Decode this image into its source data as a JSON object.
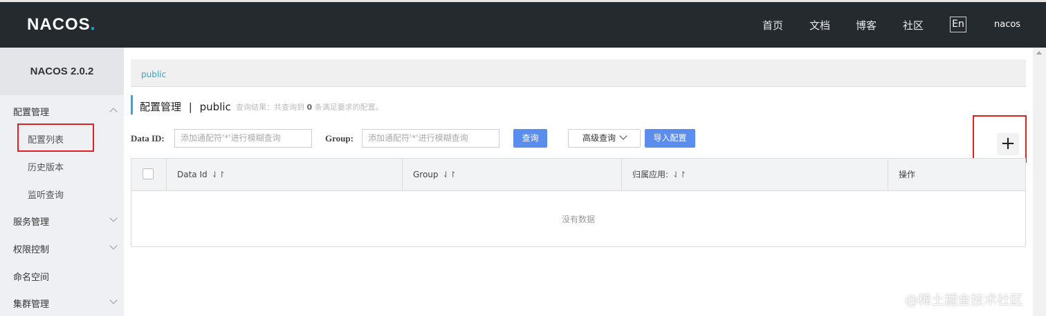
{
  "header": {
    "logo": "NACOS",
    "logo_dot": ".",
    "nav": [
      "首页",
      "文档",
      "博客",
      "社区"
    ],
    "lang": "En",
    "user": "nacos"
  },
  "sidebar": {
    "version": "NACOS 2.0.2",
    "groups": [
      {
        "label": "配置管理",
        "expanded": true,
        "items": [
          "配置列表",
          "历史版本",
          "监听查询"
        ]
      },
      {
        "label": "服务管理",
        "expanded": false
      },
      {
        "label": "权限控制",
        "expanded": false
      },
      {
        "label": "命名空间"
      },
      {
        "label": "集群管理",
        "expanded": false
      }
    ]
  },
  "main": {
    "breadcrumb": "public",
    "title": "配置管理",
    "title_sep": "|",
    "namespace": "public",
    "result_prefix": "查询结果：共查询到",
    "result_count": "0",
    "result_suffix": "条满足要求的配置。",
    "filters": {
      "data_id_label": "Data ID:",
      "data_id_placeholder": "添加通配符'*'进行模糊查询",
      "group_label": "Group:",
      "group_placeholder": "添加通配符'*'进行模糊查询",
      "search_button": "查询",
      "advanced_button": "高级查询",
      "import_button": "导入配置"
    },
    "add_button": "+",
    "table": {
      "columns": [
        "Data Id",
        "Group",
        "归属应用:",
        "操作"
      ],
      "sort_glyph": "⇃↾",
      "empty_text": "没有数据"
    }
  },
  "watermark": "@稀土掘金技术社区",
  "colors": {
    "header_bg": "#252a2f",
    "accent": "#2ea8d6",
    "primary_button": "#5b8def",
    "highlight": "#e02020"
  }
}
